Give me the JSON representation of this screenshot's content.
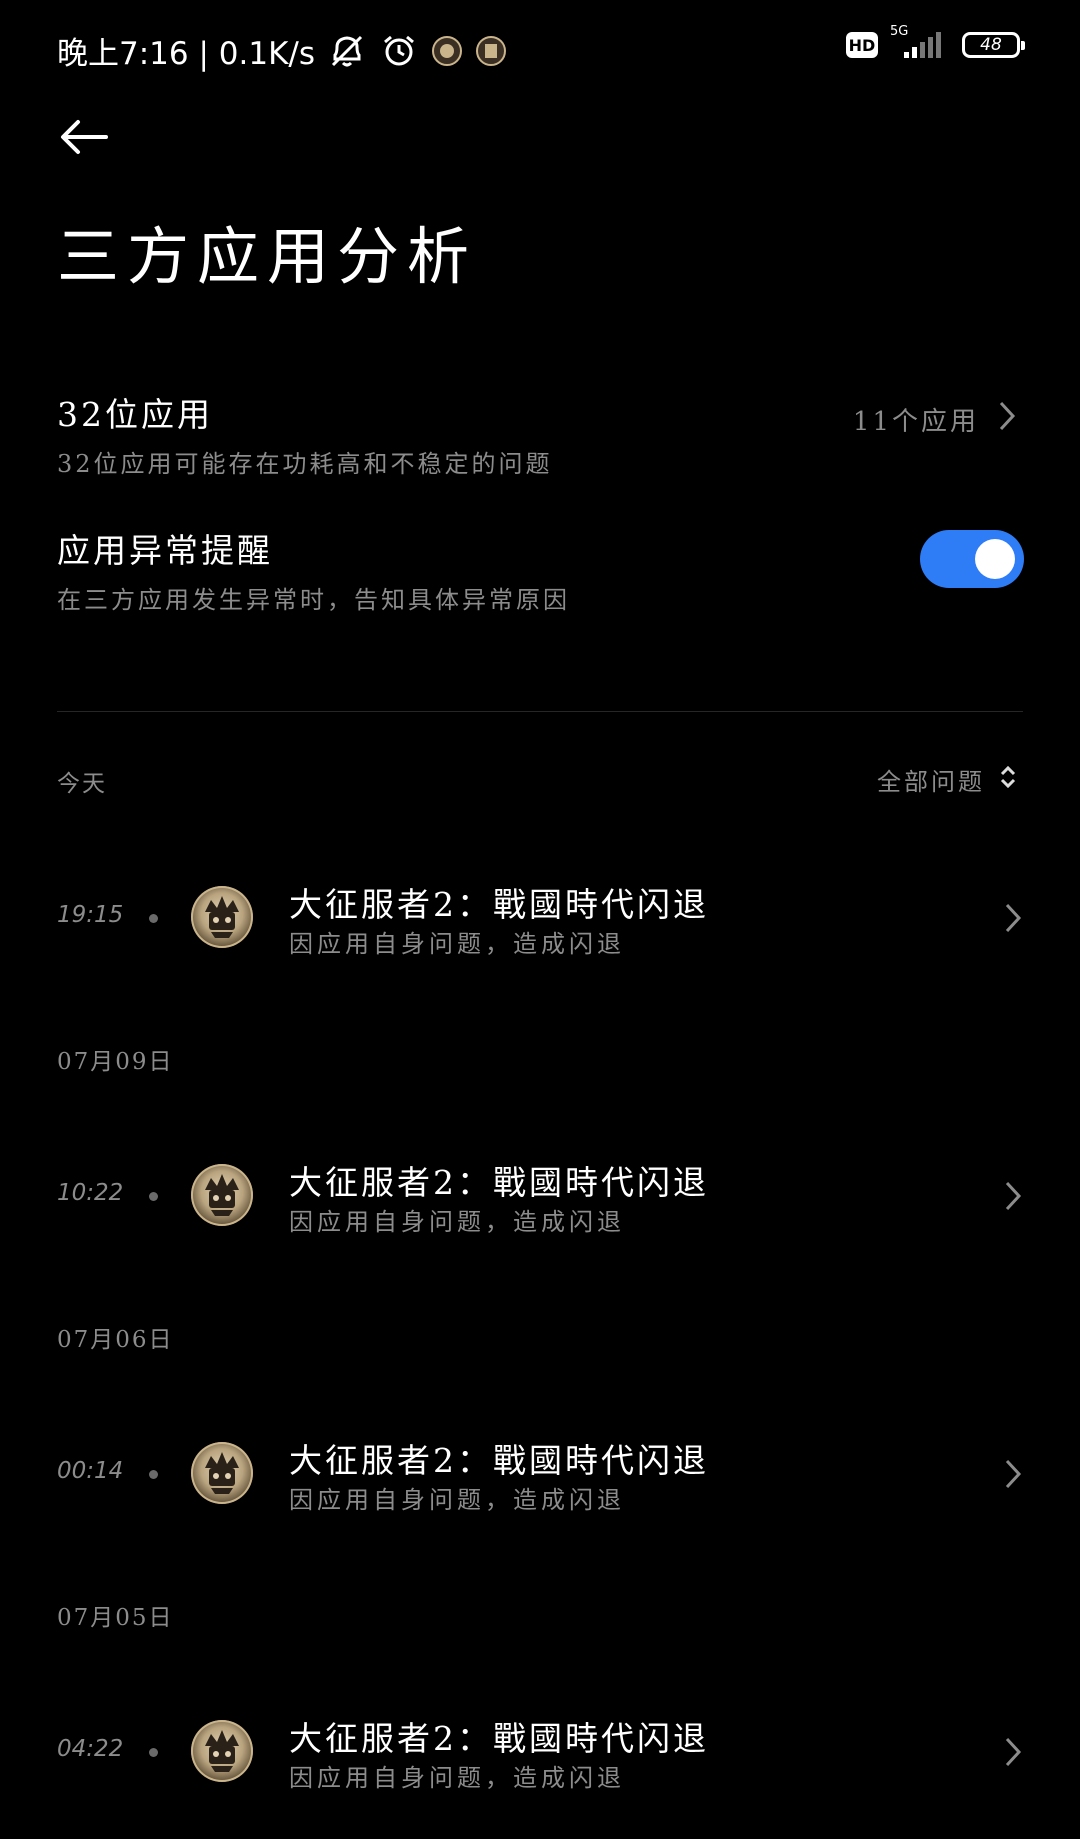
{
  "status_bar": {
    "time_speed": "晚上7:16 | 0.1K/s",
    "network_type": "5G",
    "hd_badge": "HD",
    "battery_level": "48",
    "icons": [
      "mute-icon",
      "alarm-icon",
      "app-notification-icon",
      "app-notification-icon-2",
      "signal-icon",
      "battery-icon"
    ]
  },
  "header": {
    "title": "三方应用分析"
  },
  "settings": {
    "bit32": {
      "title": "32位应用",
      "subtitle": "32位应用可能存在功耗高和不稳定的问题",
      "value": "11个应用"
    },
    "exception_alert": {
      "title": "应用异常提醒",
      "subtitle": "在三方应用发生异常时，告知具体异常原因",
      "enabled": true
    }
  },
  "log": {
    "today_label": "今天",
    "filter_label": "全部问题",
    "groups": [
      {
        "date": "今天",
        "events": [
          {
            "time": "19:15",
            "title": "大征服者2：戰國時代闪退",
            "subtitle": "因应用自身问题，造成闪退"
          }
        ]
      },
      {
        "date": "07月09日",
        "events": [
          {
            "time": "10:22",
            "title": "大征服者2：戰國時代闪退",
            "subtitle": "因应用自身问题，造成闪退"
          }
        ]
      },
      {
        "date": "07月06日",
        "events": [
          {
            "time": "00:14",
            "title": "大征服者2：戰國時代闪退",
            "subtitle": "因应用自身问题，造成闪退"
          }
        ]
      },
      {
        "date": "07月05日",
        "events": [
          {
            "time": "04:22",
            "title": "大征服者2：戰國時代闪退",
            "subtitle": "因应用自身问题，造成闪退"
          }
        ]
      }
    ]
  },
  "colors": {
    "background": "#000000",
    "accent": "#2e7cf6",
    "secondary_text": "#8c8c8c"
  }
}
